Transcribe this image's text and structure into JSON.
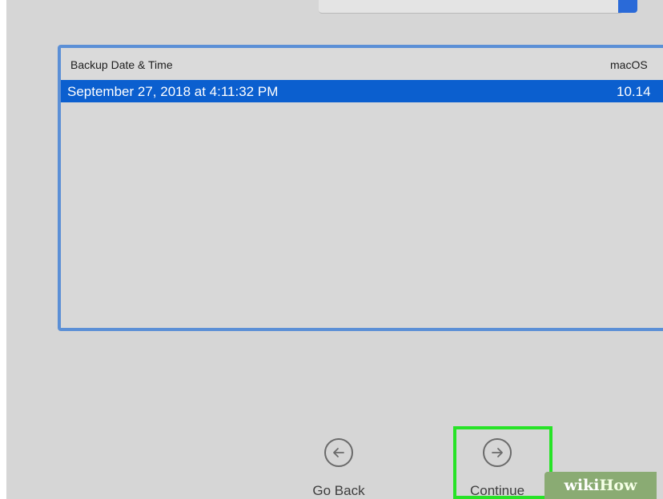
{
  "window": {
    "background": "#d6d6d6"
  },
  "table": {
    "headers": [
      "Backup Date & Time",
      "macOS"
    ],
    "rows": [
      {
        "date_time": "September 27, 2018 at 4:11:32 PM",
        "version": "10.14"
      }
    ]
  },
  "navigation": {
    "back": {
      "label": "Go Back",
      "icon": "arrow-left-circle-icon"
    },
    "continue": {
      "label": "Continue",
      "icon": "arrow-right-circle-icon"
    }
  },
  "colors": {
    "accent": "#0b5fcf",
    "table_border": "#5b8fd6",
    "highlight": "#27e327",
    "watermark_bg": "#8aab73"
  },
  "watermark": {
    "text_a": "wiki",
    "text_b": "How"
  }
}
